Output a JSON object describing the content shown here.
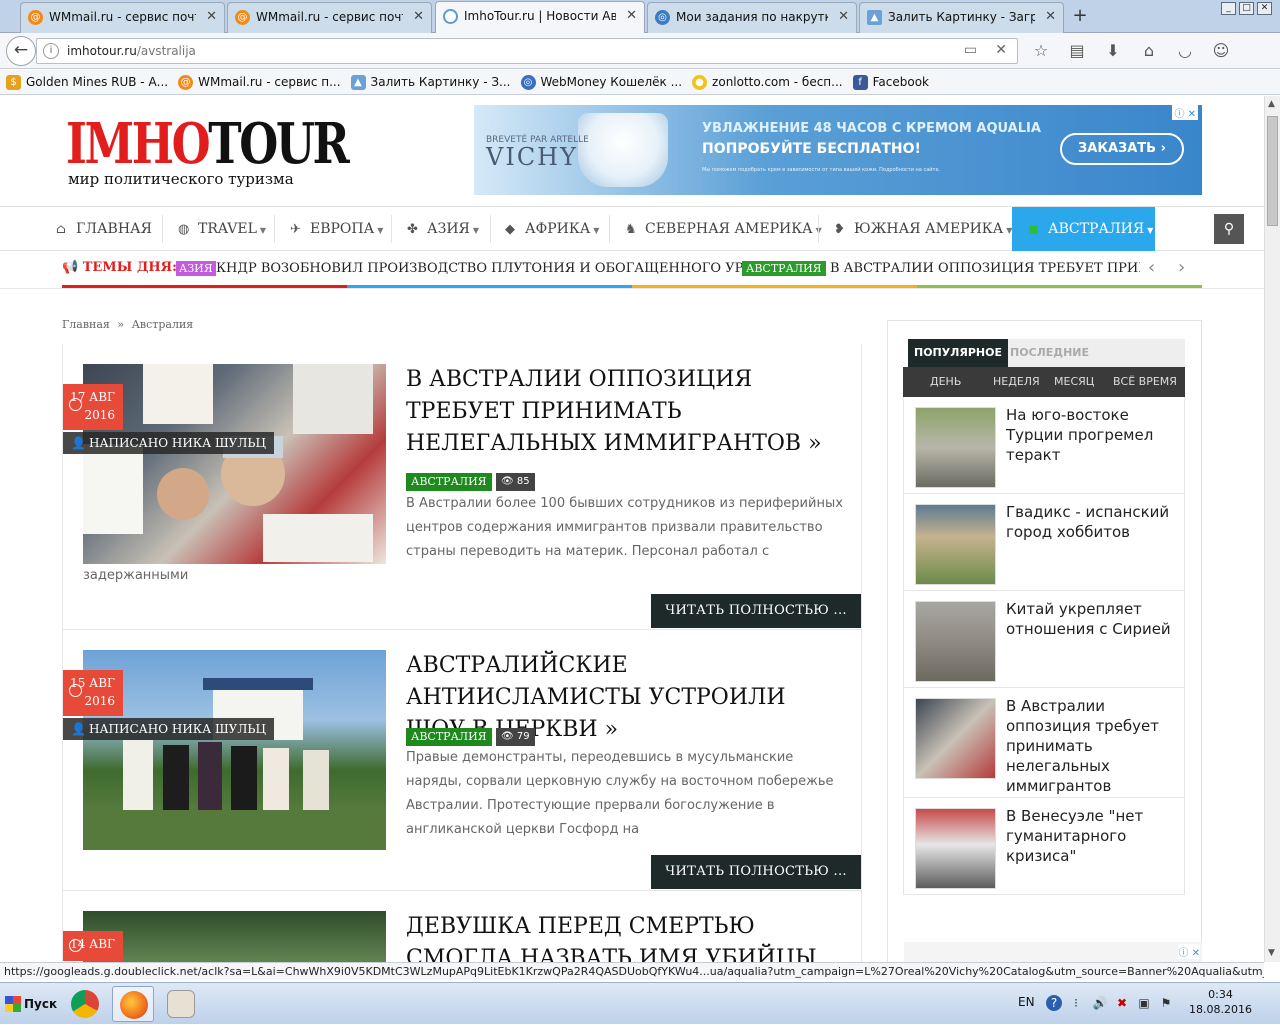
{
  "browser": {
    "tabs": [
      {
        "title": "WMmail.ru - сервис почтовы...",
        "icon": "wmmail-icon",
        "active": false
      },
      {
        "title": "WMmail.ru - сервис почтовы...",
        "icon": "wmmail-icon",
        "active": false
      },
      {
        "title": "ImhoTour.ru | Новости Авст...",
        "icon": "loading-icon",
        "active": true
      },
      {
        "title": "Мои задания по накрутке",
        "icon": "task-icon",
        "active": false
      },
      {
        "title": "Залить Картинку - Загрузи...",
        "icon": "image-host-icon",
        "active": false
      }
    ],
    "url_host": "imhotour.ru",
    "url_path": "/avstralija",
    "bookmarks": [
      {
        "label": "Golden Mines RUB - А...",
        "icon": "coin-icon",
        "color": "#e6a21e"
      },
      {
        "label": "WMmail.ru - сервис п...",
        "icon": "wmmail-icon",
        "color": "#f08a1a"
      },
      {
        "label": "Залить Картинку - З...",
        "icon": "image-host-icon",
        "color": "#6aa2d8"
      },
      {
        "label": "WebMoney Кошелёк ...",
        "icon": "webmoney-icon",
        "color": "#3a6fc0"
      },
      {
        "label": "zonlotto.com - бесп...",
        "icon": "lotto-icon",
        "color": "#f0c419"
      },
      {
        "label": "Facebook",
        "icon": "facebook-icon",
        "color": "#3b5998"
      }
    ],
    "status_url": "https://googleads.g.doubleclick.net/aclk?sa=L&ai=ChwWhX9i0V5KDMtC3WLzMupAPq9LitEbK1KrzwQPa2R4QASDUobQfYKWu4...ua/aqualia?utm_campaign=L%27Oreal%20Vichy%20Catalog&utm_source=Banner%20Aqualia&utm_medium=%2FGDN%20Aqualia"
  },
  "site": {
    "logo_imho": "IMHO",
    "logo_tour": "TOUR",
    "tagline": "мир политического туризма",
    "ad": {
      "brand_line": "BREVETÉ PAR ARTELLE",
      "brand": "VICHY",
      "line1": "УВЛАЖНЕНИЕ 48 ЧАСОВ С КРЕМОМ AQUALIA",
      "line2": "ПОПРОБУЙТЕ БЕСПЛАТНО!",
      "small": "Мы поможем подобрать крем в зависимости от типа вашей кожи. Подробности на сайте.",
      "button": "ЗАКАЗАТЬ"
    },
    "nav": [
      {
        "label": "ГЛАВНАЯ",
        "icon": "home-icon",
        "caret": false
      },
      {
        "label": "TRAVEL",
        "icon": "globe-icon",
        "caret": true
      },
      {
        "label": "ЕВРОПА",
        "icon": "europe-map-icon",
        "caret": true
      },
      {
        "label": "АЗИЯ",
        "icon": "asia-map-icon",
        "caret": true
      },
      {
        "label": "АФРИКА",
        "icon": "africa-map-icon",
        "caret": true
      },
      {
        "label": "СЕВЕРНАЯ АМЕРИКА",
        "icon": "north-america-map-icon",
        "caret": true
      },
      {
        "label": "ЮЖНАЯ АМЕРИКА",
        "icon": "south-america-map-icon",
        "caret": true
      },
      {
        "label": "АВСТРАЛИЯ",
        "icon": "australia-map-icon",
        "caret": true
      }
    ],
    "ticker": {
      "label": "ТЕМЫ ДНЯ:",
      "cat1": "АЗИЯ",
      "item1": "КНДР ВОЗОБНОВИЛ ПРОИЗВОДСТВО ПЛУТОНИЯ И ОБОГАЩЕННОГО УРАНА",
      "cat2": "АВСТРАЛИЯ",
      "item2": "В АВСТРАЛИИ ОППОЗИЦИЯ ТРЕБУЕТ ПРИНИМАТЬ НЕЛЕГАЛЬНЫХ ИММИГРАНТОВ"
    },
    "breadcrumb": {
      "home": "Главная",
      "sep": "»",
      "current": "Австралия"
    }
  },
  "articles": [
    {
      "day": "17 АВГ",
      "year": "2016",
      "author": "НАПИСАНО НИКА ШУЛЬЦ",
      "title": "В АВСТРАЛИИ ОППОЗИЦИЯ ТРЕБУЕТ ПРИНИМАТЬ НЕЛЕГАЛЬНЫХ ИММИГРАНТОВ »",
      "category": "АВСТРАЛИЯ",
      "views": "85",
      "excerpt": "В Австралии более 100 бывших сотрудников из периферийных центров содержания иммигрантов призвали правительство страны переводить на материк. Персонал работал с",
      "excerpt_tail": "задержанными",
      "read_more": "ЧИТАТЬ ПОЛНОСТЬЮ ..."
    },
    {
      "day": "15 АВГ",
      "year": "2016",
      "author": "НАПИСАНО НИКА ШУЛЬЦ",
      "title": "АВСТРАЛИЙСКИЕ АНТИИСЛАМИСТЫ УСТРОИЛИ ШОУ В ЦЕРКВИ »",
      "category": "АВСТРАЛИЯ",
      "views": "79",
      "excerpt": "Правые демонстранты, переодевшись в мусульманские наряды, сорвали церковную службу на восточном побережье Австралии. Протестующие прервали богослужение в англиканской церкви Госфорд на",
      "read_more": "ЧИТАТЬ ПОЛНОСТЬЮ ..."
    },
    {
      "day": "14 АВГ",
      "title": "ДЕВУШКА ПЕРЕД СМЕРТЬЮ СМОГЛА НАЗВАТЬ ИМЯ УБИЙЦЫ"
    }
  ],
  "sidebar": {
    "tab_popular": "ПОПУЛЯРНОЕ",
    "tab_latest": "ПОСЛЕДНИЕ",
    "periods": [
      "ДЕНЬ",
      "НЕДЕЛЯ",
      "МЕСЯЦ",
      "ВСЁ ВРЕМЯ"
    ],
    "items": [
      {
        "title": "На юго-востоке Турции прогремел теракт"
      },
      {
        "title": "Гвадикс - испанский город хоббитов"
      },
      {
        "title": "Китай укрепляет отношения с Сирией"
      },
      {
        "title": "В Австралии оппозиция требует принимать нелегальных иммигрантов"
      },
      {
        "title": "В Венесуэле \"нет гуманитарного кризиса\""
      }
    ]
  },
  "taskbar": {
    "start": "Пуск",
    "lang": "EN",
    "time": "0:34",
    "date": "18.08.2016"
  }
}
